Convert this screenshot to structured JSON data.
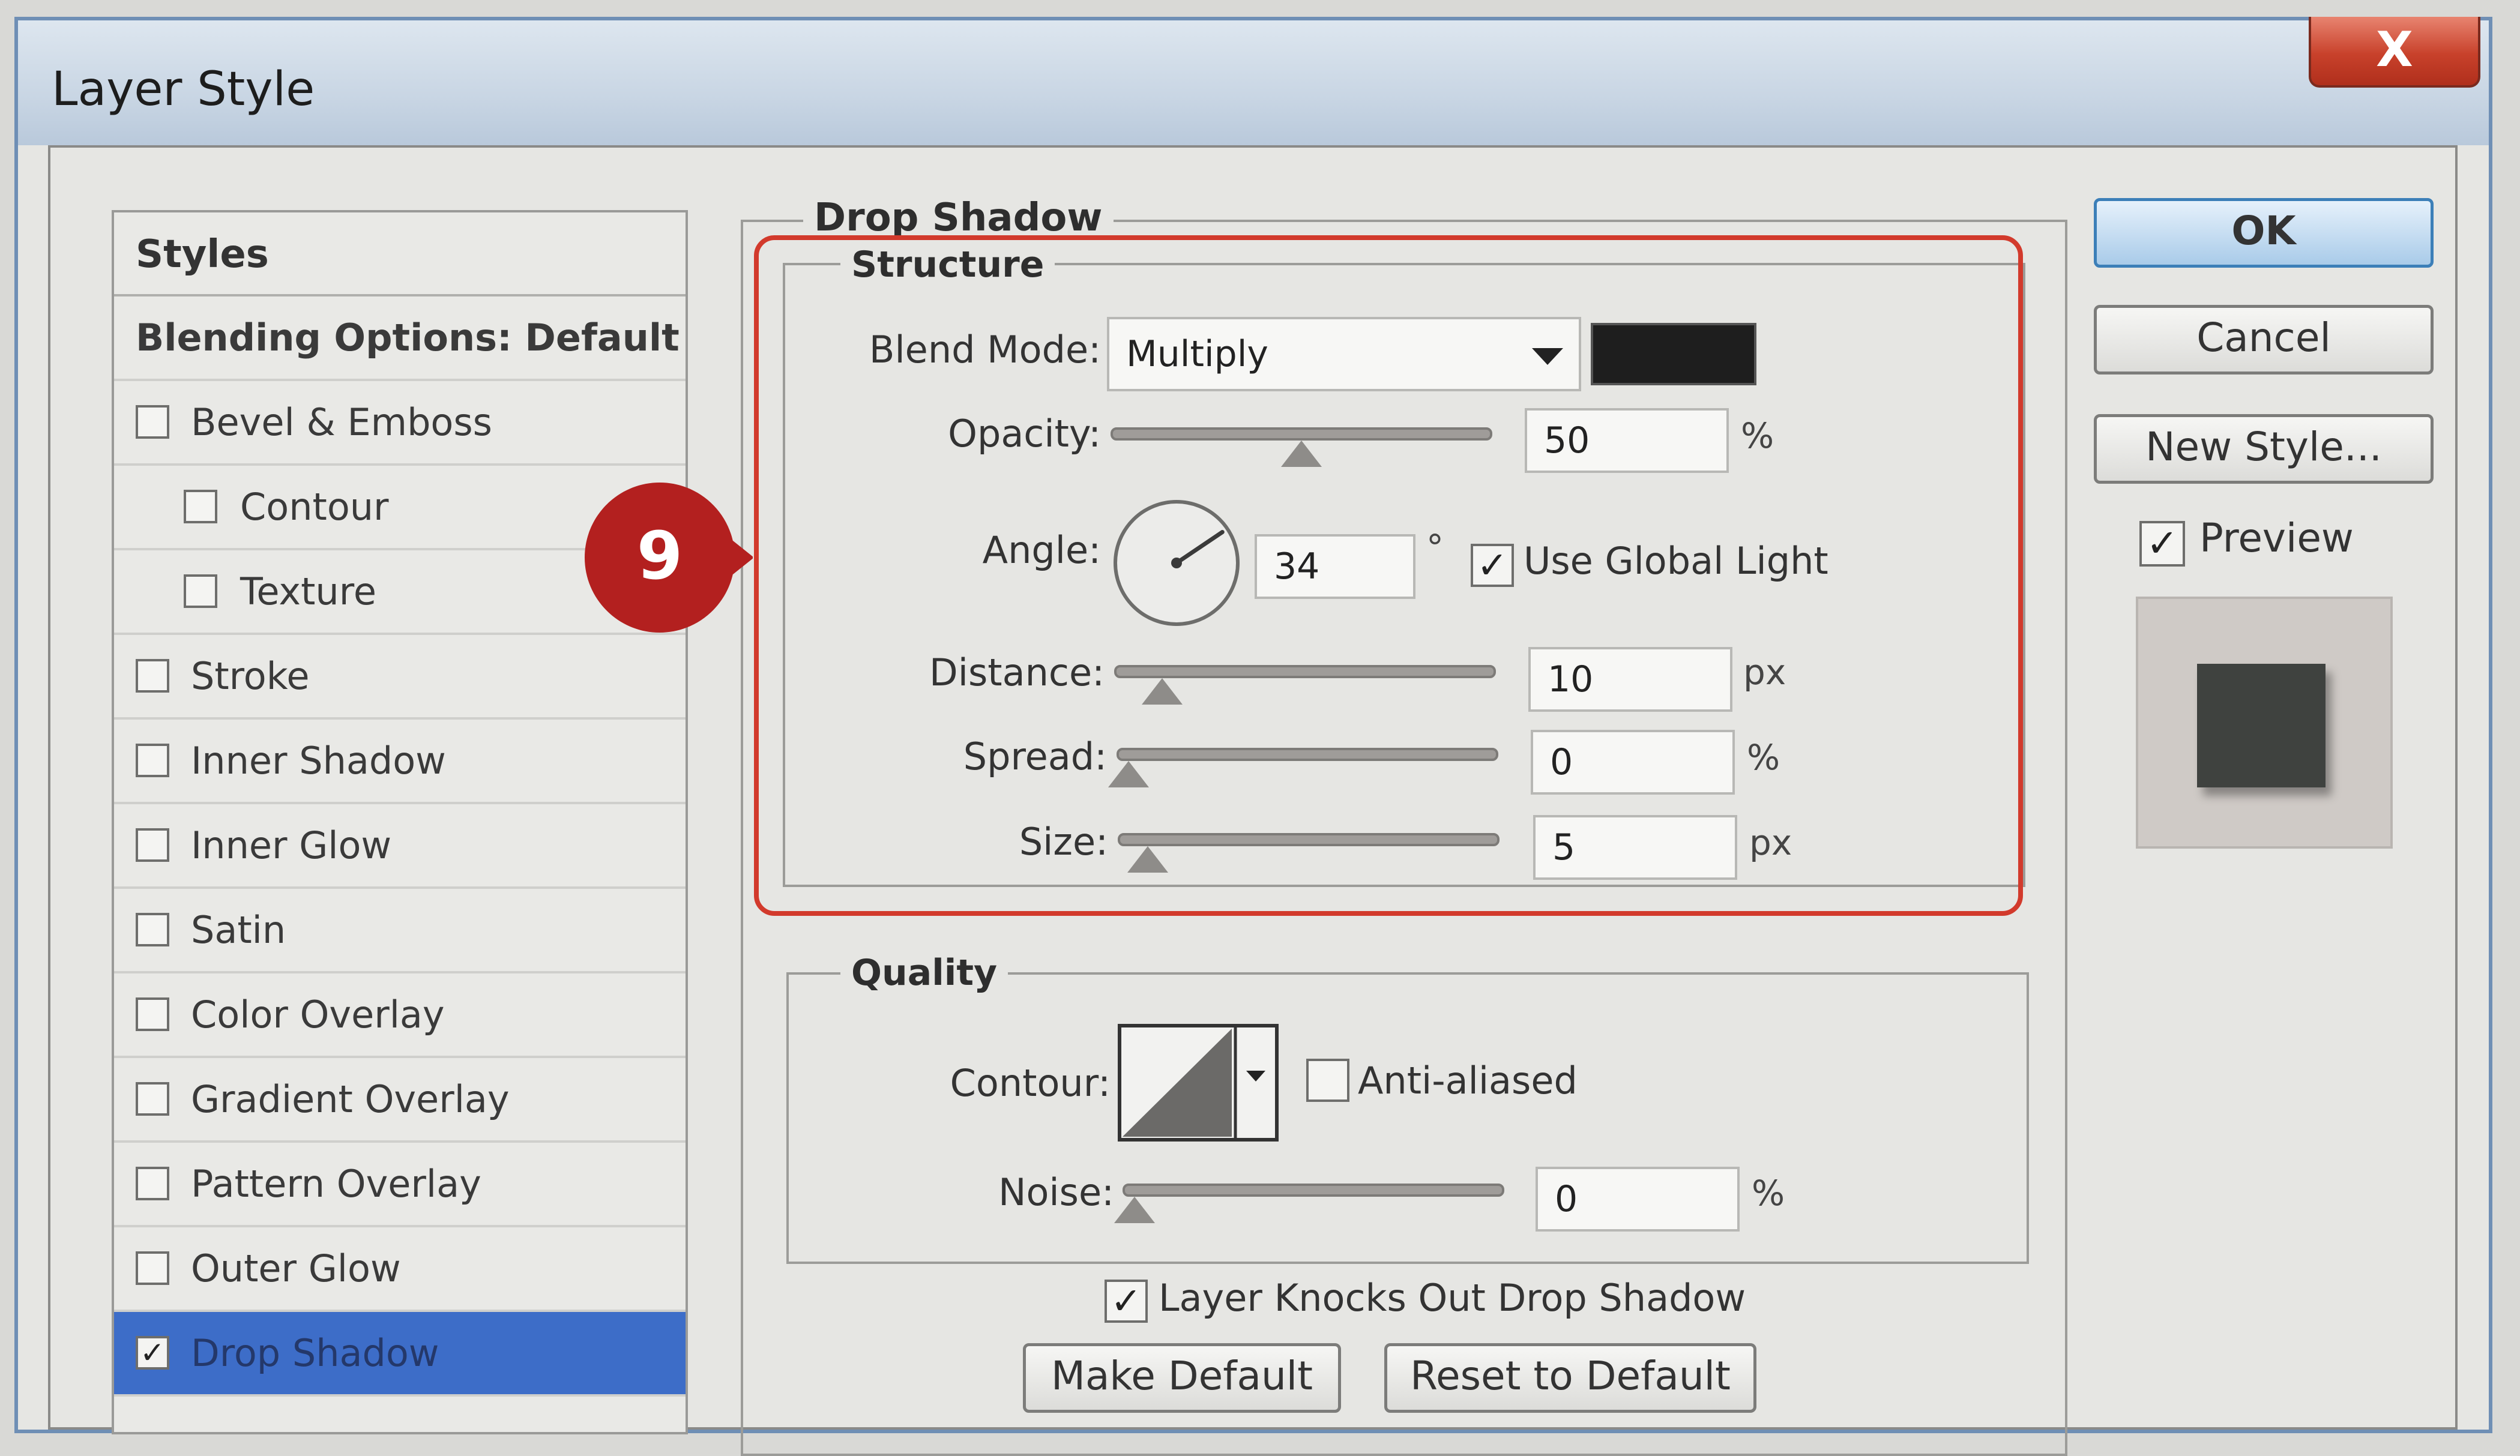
{
  "window": {
    "title": "Layer Style",
    "close_label": "X"
  },
  "style_list": {
    "header": "Styles",
    "blending_options": "Blending Options: Default",
    "items": [
      {
        "label": "Bevel & Emboss",
        "checked": false,
        "indent": false
      },
      {
        "label": "Contour",
        "checked": false,
        "indent": true
      },
      {
        "label": "Texture",
        "checked": false,
        "indent": true
      },
      {
        "label": "Stroke",
        "checked": false,
        "indent": false
      },
      {
        "label": "Inner Shadow",
        "checked": false,
        "indent": false
      },
      {
        "label": "Inner Glow",
        "checked": false,
        "indent": false
      },
      {
        "label": "Satin",
        "checked": false,
        "indent": false
      },
      {
        "label": "Color Overlay",
        "checked": false,
        "indent": false
      },
      {
        "label": "Gradient Overlay",
        "checked": false,
        "indent": false
      },
      {
        "label": "Pattern Overlay",
        "checked": false,
        "indent": false
      },
      {
        "label": "Outer Glow",
        "checked": false,
        "indent": false
      },
      {
        "label": "Drop Shadow",
        "checked": true,
        "indent": false,
        "selected": true
      }
    ]
  },
  "drop_shadow": {
    "section_title": "Drop Shadow",
    "structure": {
      "title": "Structure",
      "blend_mode_label": "Blend Mode:",
      "blend_mode_value": "Multiply",
      "shadow_color": "#1e1e1e",
      "opacity_label": "Opacity:",
      "opacity_value": "50",
      "opacity_unit": "%",
      "opacity_level": 0.5,
      "angle_label": "Angle:",
      "angle_value": "34",
      "angle_unit": "°",
      "angle_degrees": 34,
      "use_global_light_label": "Use Global Light",
      "use_global_light": true,
      "distance_label": "Distance:",
      "distance_value": "10",
      "distance_unit": "px",
      "distance_level": 0.1,
      "spread_label": "Spread:",
      "spread_value": "0",
      "spread_unit": "%",
      "spread_level": 0.0,
      "size_label": "Size:",
      "size_value": "5",
      "size_unit": "px",
      "size_level": 0.05
    },
    "quality": {
      "title": "Quality",
      "contour_label": "Contour:",
      "anti_aliased_label": "Anti-aliased",
      "anti_aliased": false,
      "noise_label": "Noise:",
      "noise_value": "0",
      "noise_unit": "%",
      "noise_level": 0.0
    },
    "knocks_out_label": "Layer Knocks Out Drop Shadow",
    "knocks_out": true,
    "make_default_label": "Make Default",
    "reset_default_label": "Reset to Default"
  },
  "buttons": {
    "ok": "OK",
    "cancel": "Cancel",
    "new_style": "New Style...",
    "preview_label": "Preview",
    "preview_checked": true
  },
  "callout": {
    "number": "9",
    "color": "#b3201f"
  },
  "check_glyph": "✓"
}
